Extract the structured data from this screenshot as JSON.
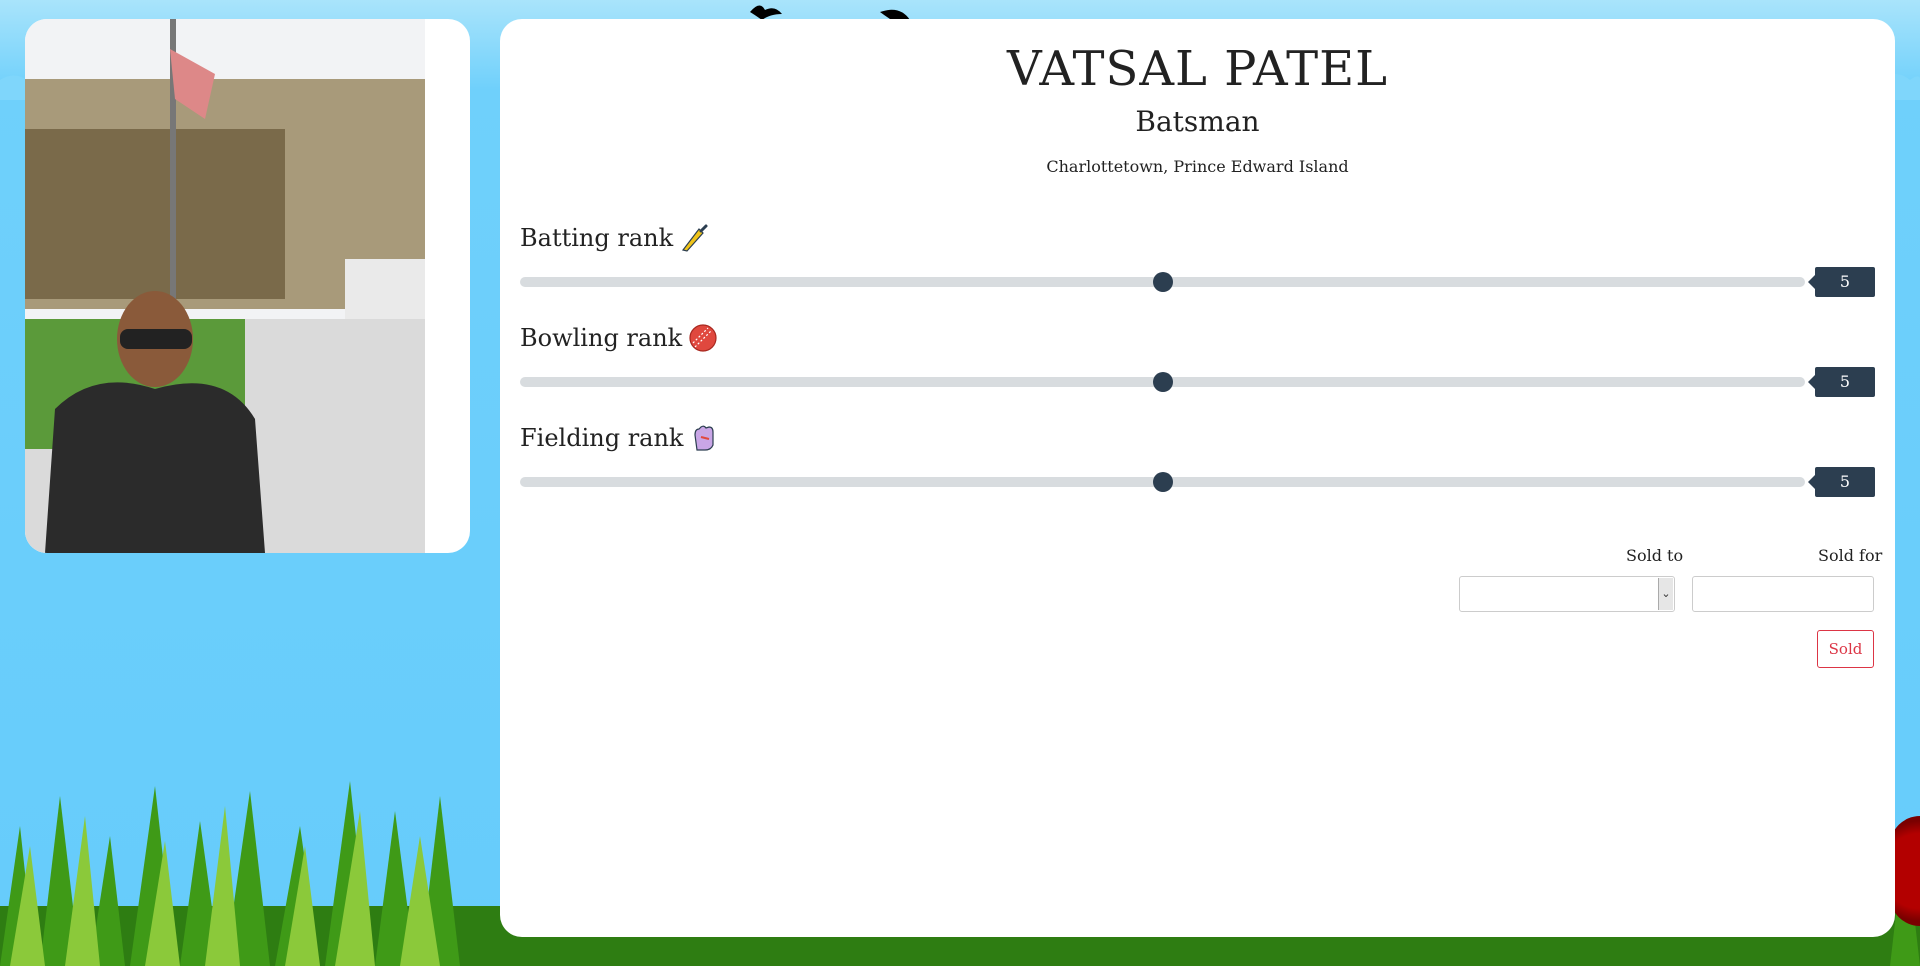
{
  "player": {
    "name": "VATSAL PATEL",
    "role": "Batsman",
    "location": "Charlottetown, Prince Edward Island"
  },
  "ranks": [
    {
      "label": "Batting rank",
      "icon": "cricket-bat-icon",
      "value": 5,
      "min": 0,
      "max": 10,
      "value_text": "5"
    },
    {
      "label": "Bowling rank",
      "icon": "cricket-ball-icon",
      "value": 5,
      "min": 0,
      "max": 10,
      "value_text": "5"
    },
    {
      "label": "Fielding rank",
      "icon": "fielding-glove-icon",
      "value": 5,
      "min": 0,
      "max": 10,
      "value_text": "5"
    }
  ],
  "sale": {
    "sold_to_label": "Sold to",
    "sold_to_value": "",
    "sold_for_label": "Sold for",
    "sold_for_value": "",
    "sold_button": "Sold"
  },
  "colors": {
    "accent": "#2c3e50",
    "danger": "#dc3545",
    "sky": "#66ccfb"
  }
}
